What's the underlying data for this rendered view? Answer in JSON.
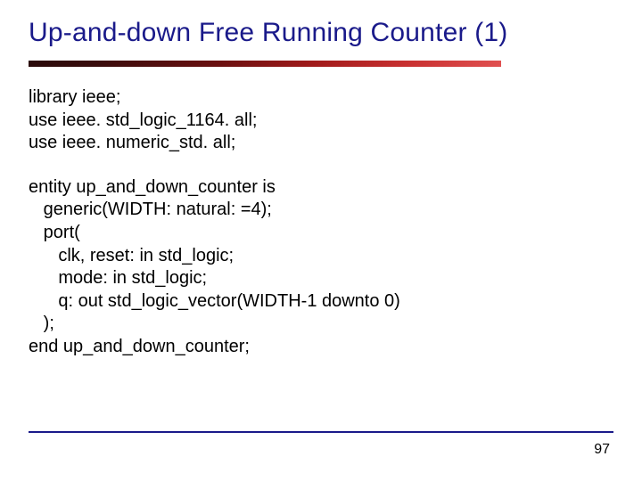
{
  "title": "Up-and-down Free Running Counter (1)",
  "lib": {
    "l1": "library ieee;",
    "l2": "use ieee. std_logic_1164. all;",
    "l3": "use ieee. numeric_std. all;"
  },
  "entity": {
    "e1": "entity up_and_down_counter is",
    "e2": "   generic(WIDTH: natural: =4);",
    "e3": "   port(",
    "e4": "      clk, reset: in std_logic;",
    "e5": "      mode: in std_logic;",
    "e6": "      q: out std_logic_vector(WIDTH-1 downto 0)",
    "e7": "   );",
    "e8": "end up_and_down_counter;"
  },
  "page": "97"
}
